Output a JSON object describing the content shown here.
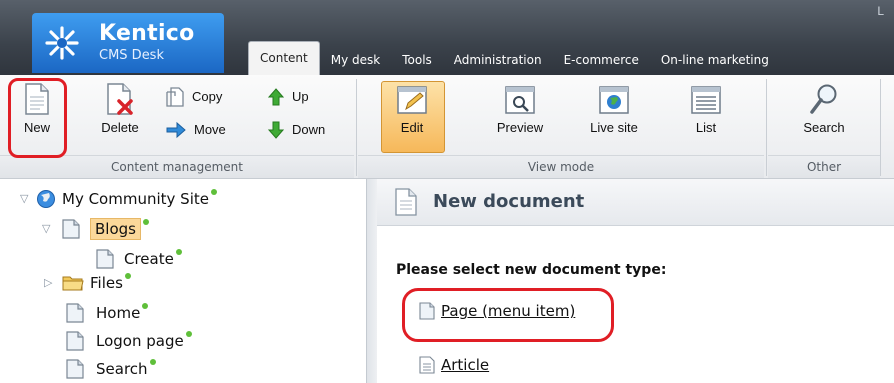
{
  "header": {
    "logo_title": "Kentico",
    "logo_subtitle": "CMS Desk",
    "corner_text": "L",
    "tabs": [
      {
        "label": "Content",
        "active": true
      },
      {
        "label": "My desk"
      },
      {
        "label": "Tools"
      },
      {
        "label": "Administration"
      },
      {
        "label": "E-commerce"
      },
      {
        "label": "On-line marketing"
      }
    ]
  },
  "ribbon": {
    "content_management": {
      "label": "Content management",
      "new": "New",
      "delete": "Delete",
      "copy": "Copy",
      "move": "Move",
      "up": "Up",
      "down": "Down"
    },
    "view_mode": {
      "label": "View mode",
      "edit": "Edit",
      "preview": "Preview",
      "live_site": "Live site",
      "list": "List",
      "active": "Edit"
    },
    "other": {
      "label": "Other",
      "search": "Search"
    }
  },
  "tree": {
    "root": "My Community Site",
    "items": [
      {
        "label": "Blogs",
        "selected": true
      },
      {
        "label": "Create"
      },
      {
        "label": "Files"
      },
      {
        "label": "Home"
      },
      {
        "label": "Logon page"
      },
      {
        "label": "Search"
      }
    ]
  },
  "content": {
    "title": "New document",
    "prompt": "Please select new document type:",
    "doc_types": [
      "Page (menu item)",
      "Article"
    ]
  },
  "colors": {
    "highlight_ring": "#e01e25",
    "status_dot": "#5fbf3a",
    "active_view": "#f6b85a",
    "logo_blue": "#1b67c4"
  }
}
